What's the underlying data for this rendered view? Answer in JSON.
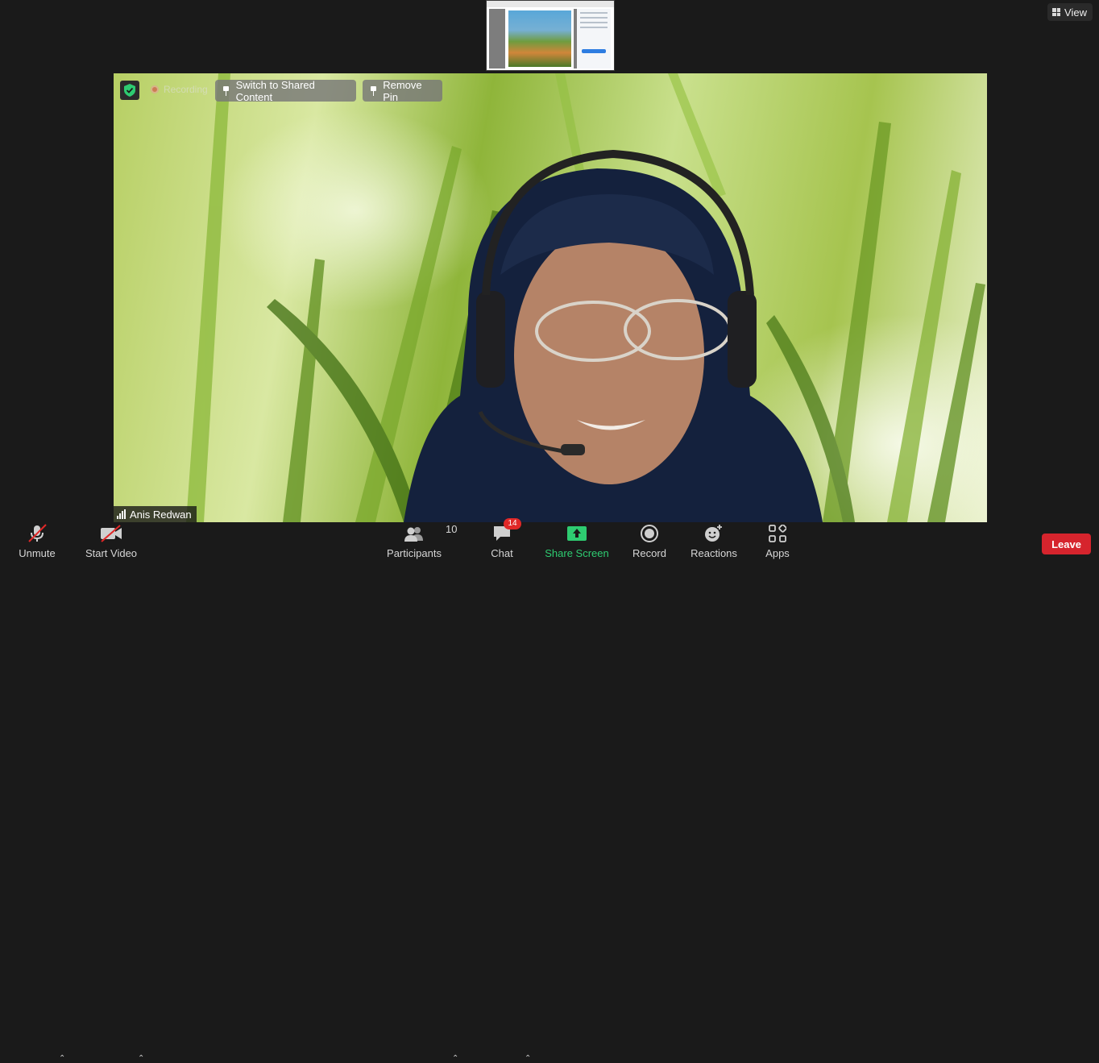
{
  "header": {
    "view_label": "View"
  },
  "video": {
    "recording_label": "Recording",
    "switch_label": "Switch to Shared Content",
    "remove_pin_label": "Remove Pin",
    "participant_name": "Anis Redwan"
  },
  "toolbar": {
    "unmute_label": "Unmute",
    "start_video_label": "Start Video",
    "participants_label": "Participants",
    "participants_count": "10",
    "chat_label": "Chat",
    "chat_badge": "14",
    "share_label": "Share Screen",
    "record_label": "Record",
    "reactions_label": "Reactions",
    "apps_label": "Apps",
    "leave_label": "Leave"
  },
  "colors": {
    "background": "#1a1a1a",
    "leave": "#d6242d",
    "share": "#2ecc71",
    "badge": "#e02828",
    "security_shield": "#2ecc71",
    "muted_slash": "#e02828"
  },
  "icons": [
    "grid-icon",
    "shield-icon",
    "record-dot-icon",
    "pin-icon",
    "signal-icon",
    "microphone-muted-icon",
    "video-off-icon",
    "participants-icon",
    "chat-icon",
    "share-screen-icon",
    "record-icon",
    "reactions-icon",
    "apps-icon",
    "chevron-up-icon"
  ]
}
